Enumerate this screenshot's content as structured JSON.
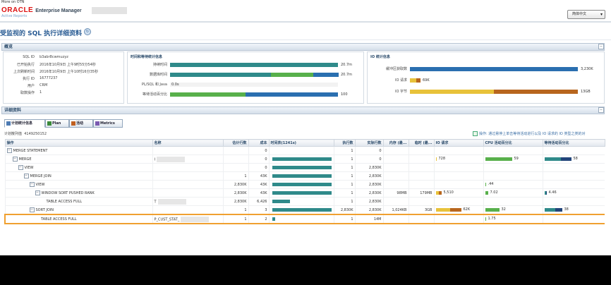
{
  "header": {
    "more_link": "More on OTN",
    "oracle": "ORACLE",
    "product": "Enterprise Manager",
    "subtitle": "Active Reports",
    "lang_button": "简体中文"
  },
  "page": {
    "title": "受监视的 SQL 执行详细资料"
  },
  "overview": {
    "heading": "概览",
    "fields": [
      {
        "label": "SQL ID",
        "value": "b3abr8cwmuzyz"
      },
      {
        "label": "已开始执行",
        "value": "2016年10月9日 上午9时55分54秒"
      },
      {
        "label": "上次刷新时间",
        "value": "2016年10月9日 上午10时16分35秒"
      },
      {
        "label": "执行 ID",
        "value": "16777237"
      },
      {
        "label": "用户",
        "value": "CRM"
      },
      {
        "label": "取数操作",
        "value": "1"
      }
    ],
    "time_stats": {
      "heading": "时间和等待统计信息",
      "rows": [
        {
          "label": "持续时间",
          "value": "20.7m",
          "fill": 1.0
        },
        {
          "label": "数据库时间",
          "value": "20.7m",
          "fill": 1.0
        },
        {
          "label": "PL/SQL 和 Java",
          "value": "0.0s",
          "fill": 0.0
        },
        {
          "label": "等待活动百分比",
          "value": "100",
          "fill": 1.0
        }
      ]
    },
    "io_stats": {
      "heading": "IO 统计信息",
      "rows": [
        {
          "label": "缓冲区获取数",
          "value": "3,230K",
          "fill": 1.0
        },
        {
          "label": "IO 请求",
          "value": "69K",
          "fill": 0.06
        },
        {
          "label": "IO 字节",
          "value": "13GB",
          "fill": 1.0
        }
      ]
    }
  },
  "details": {
    "heading": "详细资料",
    "tabs": [
      "计划统计信息",
      "Plan",
      "活动",
      "Metrics"
    ],
    "plan_hash_label": "计划散列值",
    "plan_hash_value": "4149250152",
    "note": "操作: 通过悬停上单击等待活动进行以及 IO 请求的 IO 类型之类的对",
    "columns": [
      "操作",
      "名称",
      "估计行数",
      "成本",
      "时间表(1241s)",
      "执行数",
      "实际行数",
      "内存 (最...",
      "临时 (最...",
      "IO 请求",
      "CPU 活动百分比",
      "等待活动百分比"
    ],
    "rows": [
      {
        "op": "MERGE STATEMENT",
        "indent": 0,
        "name": "",
        "est": "",
        "cost": "0",
        "tl": 0,
        "execs": "1",
        "act": "0",
        "mem": "",
        "temp": "",
        "io": "",
        "io_fill": 0,
        "cpu": "",
        "cpu_fill": 0,
        "wait": "",
        "wait_fill": 0
      },
      {
        "op": "MERGE",
        "indent": 1,
        "name": "I",
        "est": "",
        "cost": "0",
        "tl": 1,
        "execs": "1",
        "act": "0",
        "mem": "",
        "temp": "",
        "io": "728",
        "io_fill": 0.02,
        "cpu": "59",
        "cpu_fill": 0.59,
        "wait": "58",
        "wait_fill": 0.58
      },
      {
        "op": "VIEW",
        "indent": 2,
        "name": "",
        "est": "",
        "cost": "0",
        "tl": 1,
        "execs": "1",
        "act": "2,830K",
        "mem": "",
        "temp": "",
        "io": "",
        "io_fill": 0,
        "cpu": "",
        "cpu_fill": 0,
        "wait": "",
        "wait_fill": 0
      },
      {
        "op": "MERGE JOIN",
        "indent": 3,
        "name": "",
        "est": "1",
        "cost": "43K",
        "tl": 1,
        "execs": "1",
        "act": "2,830K",
        "mem": "",
        "temp": "",
        "io": "",
        "io_fill": 0,
        "cpu": "",
        "cpu_fill": 0,
        "wait": "",
        "wait_fill": 0
      },
      {
        "op": "VIEW",
        "indent": 4,
        "name": "",
        "est": "2,830K",
        "cost": "43K",
        "tl": 1,
        "execs": "1",
        "act": "2,830K",
        "mem": "",
        "temp": "",
        "io": "",
        "io_fill": 0,
        "cpu": ".44",
        "cpu_fill": 0.02,
        "wait": "",
        "wait_fill": 0
      },
      {
        "op": "WINDOW SORT PUSHED RANK",
        "indent": 5,
        "name": "",
        "est": "2,830K",
        "cost": "43K",
        "tl": 1,
        "execs": "1",
        "act": "2,830K",
        "mem": "98MB",
        "temp": "179MB",
        "io": "5,510",
        "io_fill": 0.2,
        "cpu": "7.02",
        "cpu_fill": 0.07,
        "wait": "4.46",
        "wait_fill": 0.04
      },
      {
        "op": "TABLE ACCESS FULL",
        "indent": 6,
        "name": "T",
        "est": "2,830K",
        "cost": "6,426",
        "tl": 0.3,
        "execs": "1",
        "act": "2,830K",
        "mem": "",
        "temp": "",
        "io": "",
        "io_fill": 0,
        "cpu": "",
        "cpu_fill": 0,
        "wait": "",
        "wait_fill": 0
      },
      {
        "op": "SORT JOIN",
        "indent": 4,
        "name": "",
        "est": "1",
        "cost": "3",
        "tl": 1,
        "execs": "2,830K",
        "act": "2,830K",
        "mem": "1,024KB",
        "temp": "3GB",
        "io": "62K",
        "io_fill": 0.9,
        "cpu": "32",
        "cpu_fill": 0.32,
        "wait": "38",
        "wait_fill": 0.38
      },
      {
        "op": "TABLE ACCESS FULL",
        "indent": 5,
        "name": "P_CUST_STAT_",
        "est": "1",
        "cost": "2",
        "tl": 0.05,
        "execs": "1",
        "act": "14M",
        "mem": "",
        "temp": "",
        "io": "",
        "io_fill": 0,
        "cpu": "1.75",
        "cpu_fill": 0.02,
        "wait": "",
        "wait_fill": 0,
        "highlight": true
      }
    ]
  },
  "colors": {
    "teal": "#2f8a8a",
    "green": "#58b04b",
    "blue": "#2a6fb0",
    "gold": "#e8c23a",
    "brown": "#b8661e",
    "navy": "#22447a",
    "highlight": "#f0a030"
  }
}
